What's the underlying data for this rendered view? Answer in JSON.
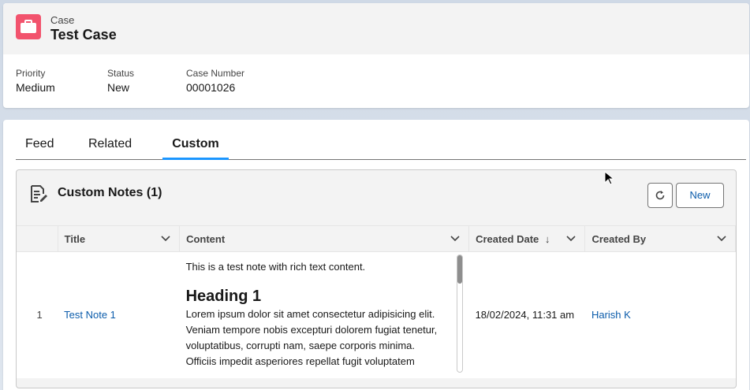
{
  "header": {
    "object_type": "Case",
    "title": "Test Case",
    "fields": [
      {
        "label": "Priority",
        "value": "Medium"
      },
      {
        "label": "Status",
        "value": "New"
      },
      {
        "label": "Case Number",
        "value": "00001026"
      }
    ]
  },
  "tabs": [
    {
      "label": "Feed",
      "active": false
    },
    {
      "label": "Related",
      "active": false
    },
    {
      "label": "Custom",
      "active": true
    }
  ],
  "related_list": {
    "title": "Custom Notes (1)",
    "icon": "notes-icon",
    "refresh_icon": "refresh-icon",
    "new_button": "New",
    "columns": [
      "Title",
      "Content",
      "Created Date",
      "Created By"
    ],
    "rows": [
      {
        "row_number": "1",
        "title": "Test Note 1",
        "content_intro": "This is a test note with rich text content.",
        "content_heading": "Heading 1",
        "content_lines": [
          "Lorem ipsum dolor sit amet consectetur adipisicing elit.",
          "Veniam tempore nobis excepturi dolorem fugiat tenetur,",
          "voluptatibus, corrupti nam, saepe corporis minima.",
          "Officiis impedit asperiores repellat fugit voluptatem"
        ],
        "created_date": "18/02/2024, 11:31 am",
        "created_by": "Harish K"
      }
    ]
  },
  "colors": {
    "case_icon": "#f2536d",
    "link": "#0b5cab",
    "active_tab": "#1b96ff"
  }
}
